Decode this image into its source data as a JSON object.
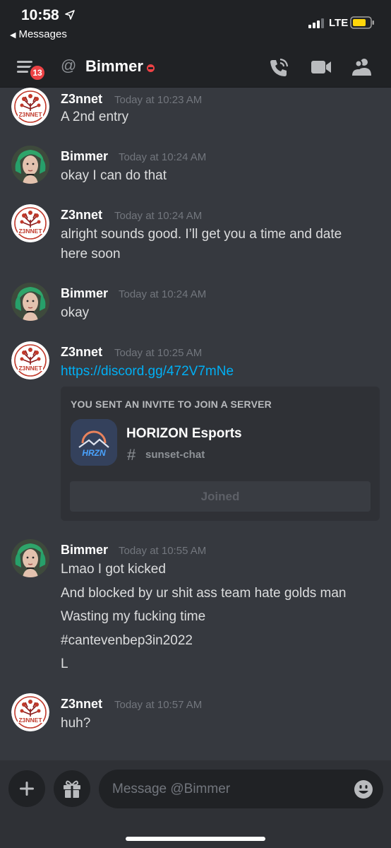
{
  "status_bar": {
    "time": "10:58",
    "back_label": "Messages",
    "network": "LTE"
  },
  "header": {
    "badge_count": "13",
    "at_symbol": "@",
    "dm_name": "Bimmer"
  },
  "messages": [
    {
      "author": "Z3nnet",
      "time": "Today at 10:23 AM",
      "lines": [
        "A 2nd entry"
      ]
    },
    {
      "author": "Bimmer",
      "time": "Today at 10:24 AM",
      "lines": [
        "okay I can do that"
      ]
    },
    {
      "author": "Z3nnet",
      "time": "Today at 10:24 AM",
      "lines": [
        "alright sounds good. I’ll get you a time and date",
        "here soon"
      ]
    },
    {
      "author": "Bimmer",
      "time": "Today at 10:24 AM",
      "lines": [
        "okay"
      ]
    },
    {
      "author": "Z3nnet",
      "time": "Today at 10:25 AM",
      "lines": [
        "https://discord.gg/472V7mNe"
      ]
    },
    {
      "author": "Bimmer",
      "time": "Today at 10:55 AM",
      "lines": [
        "Lmao I got kicked",
        "And blocked by ur shit ass team hate golds man",
        "Wasting my fucking time",
        "#cantevenbep3in2022",
        "L"
      ]
    },
    {
      "author": "Z3nnet",
      "time": "Today at 10:57 AM",
      "lines": [
        "huh?"
      ]
    }
  ],
  "avatars": {
    "z3nnet_text": "Z3NNET",
    "server_icon_text": "HRZN"
  },
  "invite": {
    "title": "YOU SENT AN INVITE TO JOIN A SERVER",
    "server_name": "HORIZON Esports",
    "channel_hash": "#",
    "channel": "sunset-chat",
    "button_label": "Joined"
  },
  "composer": {
    "placeholder": "Message @Bimmer"
  },
  "colors": {
    "background": "#36393f",
    "chrome": "#202225",
    "link": "#00aff4",
    "badge": "#ed4245",
    "timestamp": "#72767d"
  },
  "icons": [
    "location-arrow-icon",
    "signal-icon",
    "battery-icon",
    "hamburger-menu-icon",
    "phone-call-icon",
    "video-camera-icon",
    "members-icon",
    "plus-icon",
    "gift-icon",
    "emoji-icon"
  ]
}
